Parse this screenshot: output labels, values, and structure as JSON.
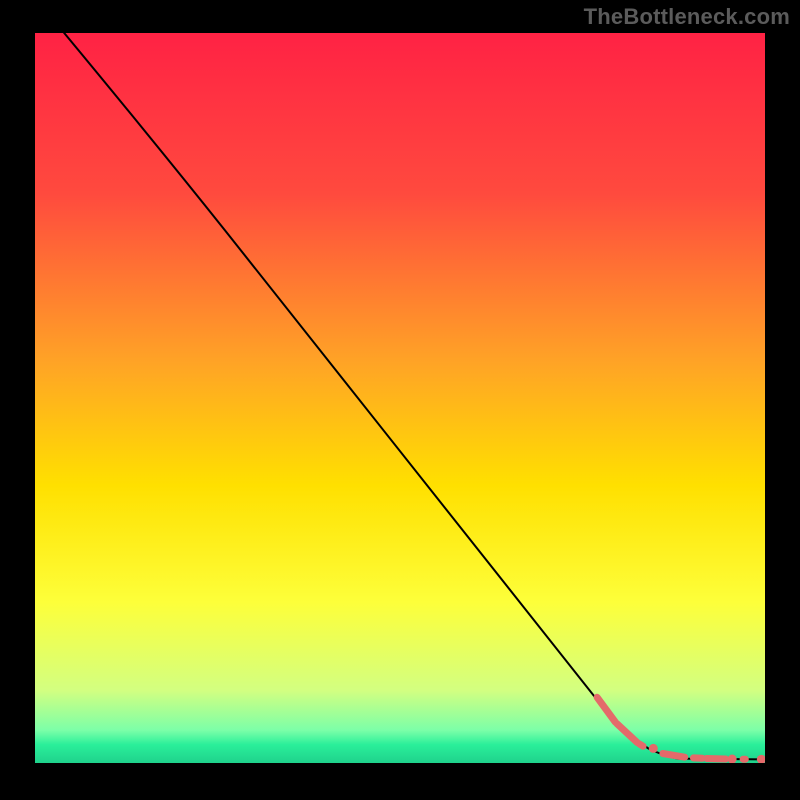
{
  "watermark": "TheBottleneck.com",
  "chart_data": {
    "type": "line",
    "title": "",
    "xlabel": "",
    "ylabel": "",
    "xlim": [
      0,
      100
    ],
    "ylim": [
      0,
      100
    ],
    "background_gradient": {
      "stops": [
        {
          "offset": 0.0,
          "color": "#ff2244"
        },
        {
          "offset": 0.22,
          "color": "#ff4a3e"
        },
        {
          "offset": 0.45,
          "color": "#ffa326"
        },
        {
          "offset": 0.62,
          "color": "#ffe000"
        },
        {
          "offset": 0.78,
          "color": "#fdff3a"
        },
        {
          "offset": 0.9,
          "color": "#d3ff80"
        },
        {
          "offset": 0.955,
          "color": "#7cffa8"
        },
        {
          "offset": 0.975,
          "color": "#2aef9a"
        },
        {
          "offset": 1.0,
          "color": "#1fd28c"
        }
      ]
    },
    "curve": {
      "name": "bottleneck-curve",
      "color": "#000000",
      "width": 2,
      "points_xy": [
        [
          4.0,
          100.0
        ],
        [
          26.0,
          73.0
        ],
        [
          79.5,
          5.5
        ],
        [
          84.0,
          2.0
        ],
        [
          88.0,
          0.6
        ],
        [
          100.0,
          0.5
        ]
      ]
    },
    "highlight_segments": {
      "name": "interest-range-markers",
      "color": "#e46a6a",
      "width": 7,
      "cap": "round",
      "segments_xy": [
        [
          [
            77.0,
            9.0
          ],
          [
            79.5,
            5.6
          ]
        ],
        [
          [
            79.7,
            5.4
          ],
          [
            82.5,
            2.8
          ]
        ],
        [
          [
            82.8,
            2.6
          ],
          [
            83.3,
            2.3
          ]
        ],
        [
          [
            86.0,
            1.3
          ],
          [
            89.0,
            0.8
          ]
        ],
        [
          [
            90.2,
            0.7
          ],
          [
            91.4,
            0.65
          ]
        ],
        [
          [
            92.0,
            0.62
          ],
          [
            94.6,
            0.55
          ]
        ],
        [
          [
            97.0,
            0.52
          ],
          [
            97.3,
            0.52
          ]
        ]
      ],
      "dots_xy": [
        [
          84.7,
          2.0
        ],
        [
          95.5,
          0.54
        ],
        [
          99.5,
          0.5
        ]
      ],
      "dot_radius": 4.5
    }
  }
}
